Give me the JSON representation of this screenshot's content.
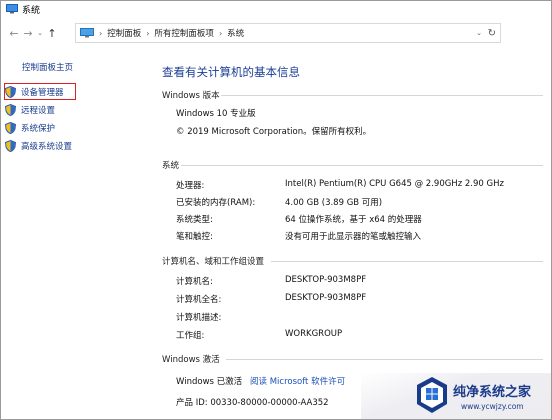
{
  "window": {
    "title": "系统"
  },
  "address_bar": {
    "crumbs": [
      "控制面板",
      "所有控制面板项",
      "系统"
    ]
  },
  "sidebar": {
    "home": "控制面板主页",
    "items": [
      {
        "label": "设备管理器",
        "highlighted": true
      },
      {
        "label": "远程设置"
      },
      {
        "label": "系统保护"
      },
      {
        "label": "高级系统设置"
      }
    ]
  },
  "main": {
    "heading": "查看有关计算机的基本信息",
    "edition": {
      "title": "Windows 版本",
      "name": "Windows 10 专业版",
      "copyright": "© 2019 Microsoft Corporation。保留所有权利。"
    },
    "system": {
      "title": "系统",
      "rows": [
        {
          "label": "处理器:",
          "value": "Intel(R) Pentium(R) CPU G645 @ 2.90GHz   2.90 GHz"
        },
        {
          "label": "已安装的内存(RAM):",
          "value": "4.00 GB (3.89 GB 可用)"
        },
        {
          "label": "系统类型:",
          "value": "64 位操作系统，基于 x64 的处理器"
        },
        {
          "label": "笔和触控:",
          "value": "没有可用于此显示器的笔或触控输入"
        }
      ]
    },
    "computer": {
      "title": "计算机名、域和工作组设置",
      "rows": [
        {
          "label": "计算机名:",
          "value": "DESKTOP-903M8PF"
        },
        {
          "label": "计算机全名:",
          "value": "DESKTOP-903M8PF"
        },
        {
          "label": "计算机描述:",
          "value": ""
        },
        {
          "label": "工作组:",
          "value": "WORKGROUP"
        }
      ]
    },
    "activation": {
      "title": "Windows 激活",
      "status": "Windows 已激活",
      "link": "阅读 Microsoft 软件许可",
      "product_id": "产品 ID: 00330-80000-00000-AA352"
    }
  },
  "watermark": {
    "title": "纯净系统之家",
    "url": "www.ycwjzy.com"
  },
  "colors": {
    "link": "#1a3d8f",
    "heading": "#1b3f95",
    "highlight_box": "#e02020"
  }
}
